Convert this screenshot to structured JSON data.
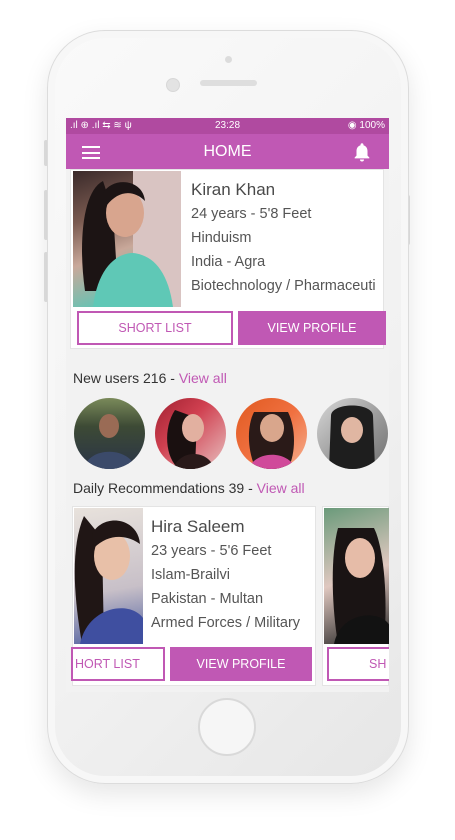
{
  "status_bar": {
    "signal": ".ıl ⊕ .ıl ⇆ ≋ ψ",
    "time": "23:28",
    "battery": "◉ 100%"
  },
  "app_bar": {
    "title": "HOME",
    "menu_icon": "menu-icon",
    "bell_icon": "bell-icon"
  },
  "featured_profile": {
    "name": "Kiran Khan",
    "age_height": "24 years - 5'8 Feet",
    "religion": "Hinduism",
    "location": "India - Agra",
    "profession": "Biotechnology / Pharmaceuti",
    "shortlist_label": "SHORT LIST",
    "view_label": "VIEW PROFILE"
  },
  "new_users": {
    "label": "New users 216 - ",
    "link": "View all"
  },
  "daily_recommendations": {
    "label": "Daily Recommendations 39 - ",
    "link": "View all",
    "cards": [
      {
        "name": "Hira Saleem",
        "age_height": "23 years - 5'6 Feet",
        "religion": "Islam-Brailvi",
        "location": "Pakistan - Multan",
        "profession": "Armed Forces / Military",
        "shortlist_label": "HORT LIST",
        "view_label": "VIEW PROFILE"
      },
      {
        "shortlist_label": "SH"
      }
    ]
  },
  "colors": {
    "accent": "#c058b4",
    "status_bar": "#b04aa0"
  }
}
